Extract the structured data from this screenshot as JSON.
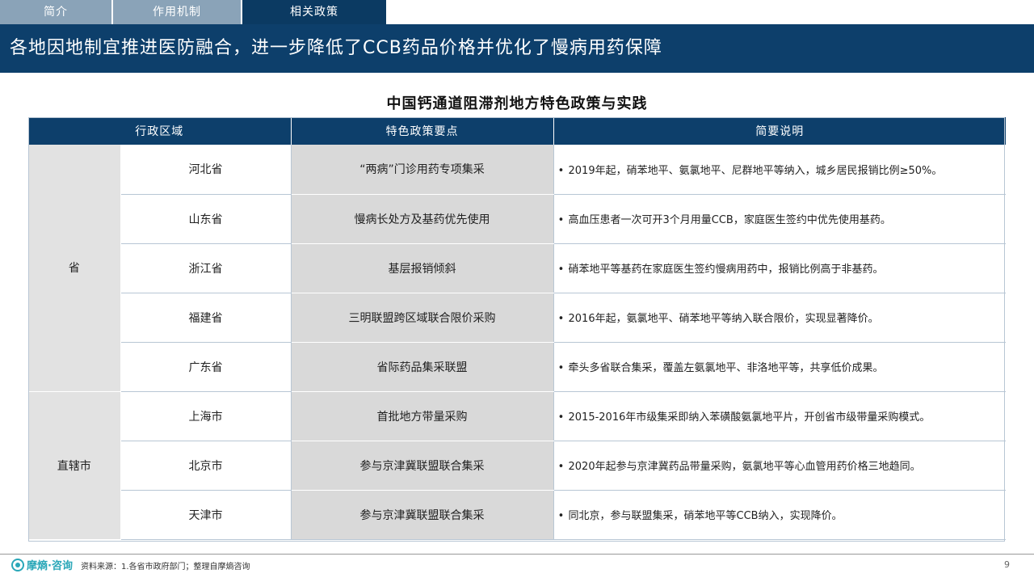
{
  "tabs": [
    {
      "label": "简介",
      "active": false
    },
    {
      "label": "作用机制",
      "active": false
    },
    {
      "label": "相关政策",
      "active": true
    }
  ],
  "banner": {
    "title": "各地因地制宜推进医防融合，进一步降低了CCB药品价格并优化了慢病用药保障"
  },
  "table": {
    "title": "中国钙通道阻滞剂地方特色政策与实践",
    "headers": [
      "行政区域",
      "特色政策要点",
      "简要说明"
    ],
    "groups": [
      {
        "level": "省",
        "rows": [
          {
            "region": "河北省",
            "policy": "“两病”门诊用药专项集采",
            "desc": "2019年起，硝苯地平、氨氯地平、尼群地平等纳入，城乡居民报销比例≥50%。"
          },
          {
            "region": "山东省",
            "policy": "慢病长处方及基药优先使用",
            "desc": "高血压患者一次可开3个月用量CCB，家庭医生签约中优先使用基药。"
          },
          {
            "region": "浙江省",
            "policy": "基层报销倾斜",
            "desc": "硝苯地平等基药在家庭医生签约慢病用药中，报销比例高于非基药。"
          },
          {
            "region": "福建省",
            "policy": "三明联盟跨区域联合限价采购",
            "desc": "2016年起，氨氯地平、硝苯地平等纳入联合限价，实现显著降价。"
          },
          {
            "region": "广东省",
            "policy": "省际药品集采联盟",
            "desc": "牵头多省联合集采，覆盖左氨氯地平、非洛地平等，共享低价成果。"
          }
        ]
      },
      {
        "level": "直辖市",
        "rows": [
          {
            "region": "上海市",
            "policy": "首批地方带量采购",
            "desc": "2015-2016年市级集采即纳入苯磺酸氨氯地平片，开创省市级带量采购模式。"
          },
          {
            "region": "北京市",
            "policy": "参与京津冀联盟联合集采",
            "desc": "2020年起参与京津冀药品带量采购，氨氯地平等心血管用药价格三地趋同。"
          },
          {
            "region": "天津市",
            "policy": "参与京津冀联盟联合集采",
            "desc": "同北京，参与联盟集采，硝苯地平等CCB纳入，实现降价。"
          }
        ]
      }
    ]
  },
  "footer": {
    "logo_text": "摩熵·咨询",
    "source": "资料来源：1.各省市政府部门；整理自摩熵咨询",
    "page_number": "9"
  },
  "colors": {
    "navy": "#0d3f6b",
    "tab_inactive": "#8aa3b8",
    "logo": "#2aa7b8"
  }
}
